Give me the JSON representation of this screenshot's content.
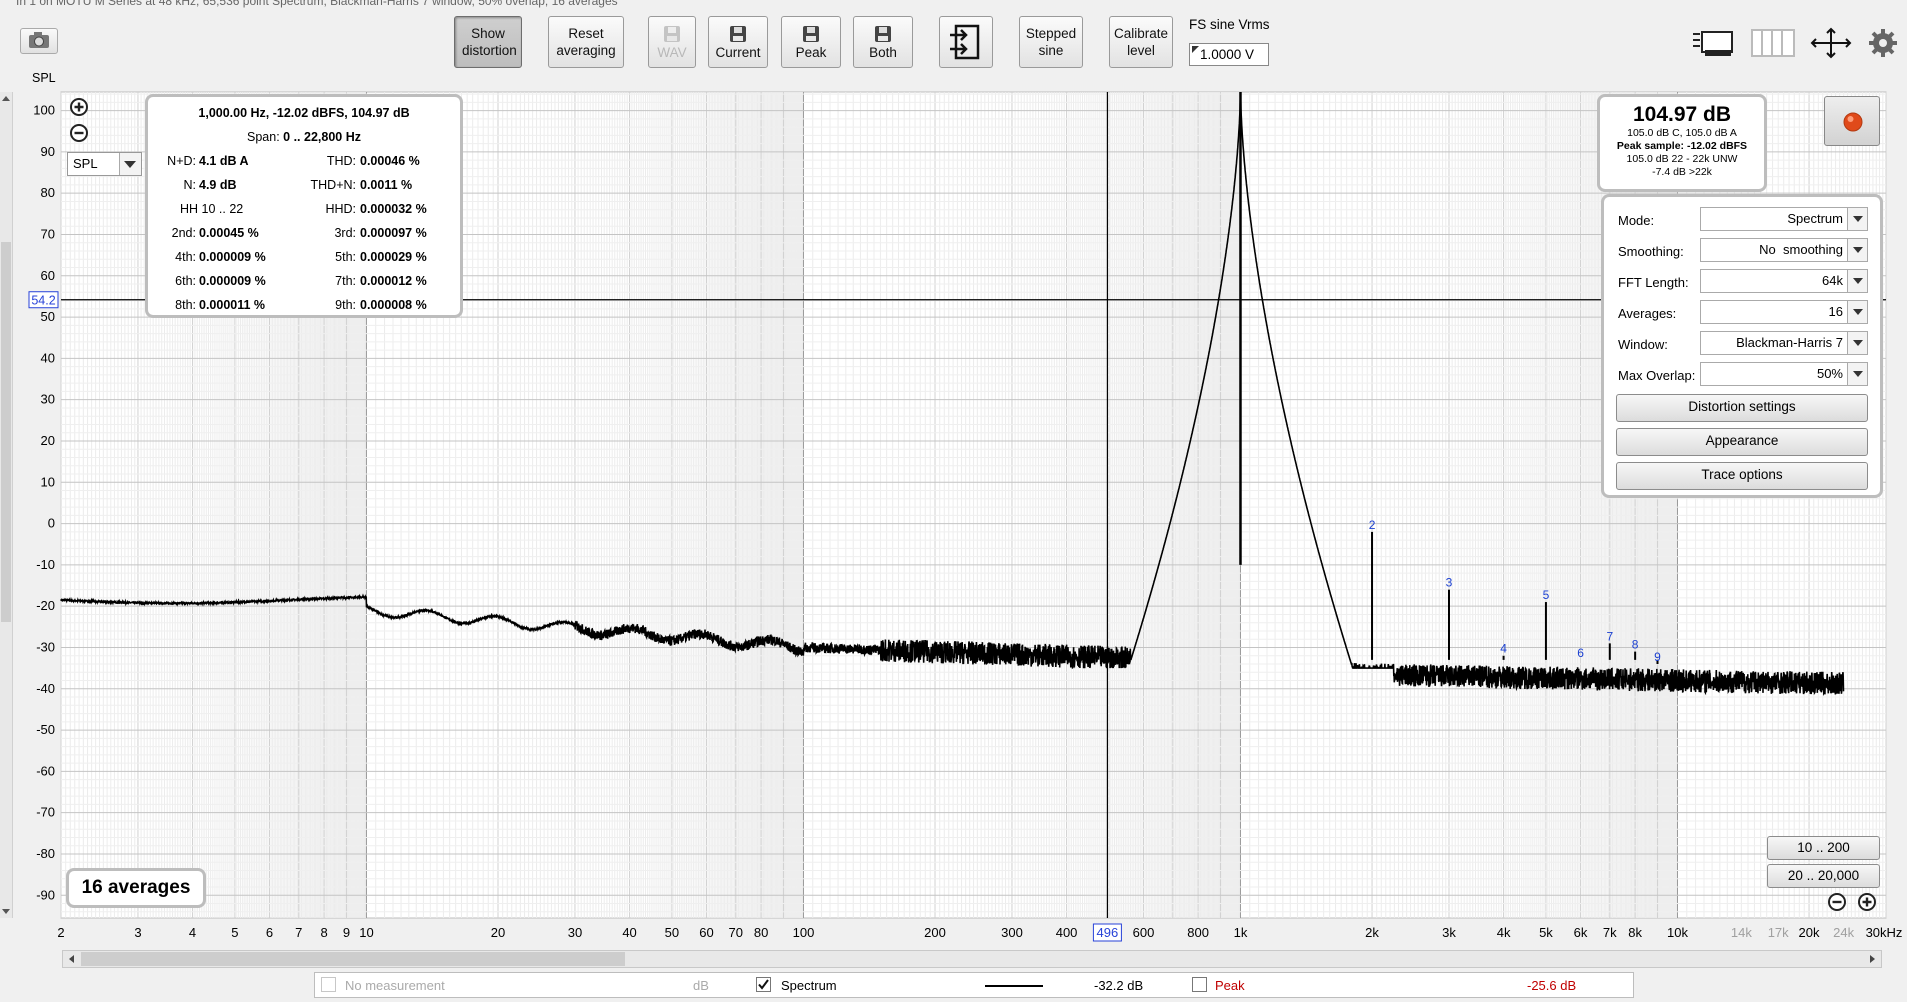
{
  "window": {
    "title": "In 1 on MOTU M Series at 48 kHz, 65,536 point Spectrum, Blackman-Harris 7 window, 50% overlap, 16 averages"
  },
  "toolbar": {
    "show_distortion": "Show distortion",
    "reset_averaging": "Reset averaging",
    "wav": "WAV",
    "current": "Current",
    "peak": "Peak",
    "both": "Both",
    "stepped_sine": "Stepped sine",
    "calibrate_level": "Calibrate level",
    "fs_sine_label": "FS sine Vrms",
    "fs_sine_value": "1.0000 V"
  },
  "graph": {
    "y_axis_title": "SPL",
    "y_ticks": [
      100,
      90,
      80,
      70,
      60,
      50,
      40,
      30,
      20,
      10,
      0,
      -10,
      -20,
      -30,
      -40,
      -50,
      -60,
      -70,
      -80,
      -90
    ],
    "x_ticks": [
      "2",
      "3",
      "4",
      "5",
      "6",
      "7",
      "8",
      "9",
      "10",
      "20",
      "30",
      "40",
      "50",
      "60",
      "70",
      "80",
      "100",
      "200",
      "300",
      "400",
      "600",
      "800",
      "1k",
      "2k",
      "3k",
      "4k",
      "5k",
      "6k",
      "7k",
      "8k",
      "10k",
      "14k",
      "17k",
      "20k",
      "24k",
      "30kHz"
    ],
    "x_ticks_grey": [
      "14k",
      "17k",
      "24k"
    ],
    "cursor_y_label": "54.2",
    "cursor_x_label": "496",
    "averages_badge": "16 averages",
    "spl_select": "SPL",
    "harmonic_markers": [
      "2",
      "3",
      "4",
      "5",
      "6",
      "7",
      "8",
      "9"
    ],
    "range_buttons": [
      "10 .. 200",
      "20 .. 20,000"
    ]
  },
  "distortion": {
    "header": "1,000.00 Hz, -12.02 dBFS, 104.97 dB",
    "span": {
      "label": "Span:",
      "value": "0 .. 22,800 Hz"
    },
    "rows": [
      {
        "l_label": "N+D:",
        "l_value": "4.1 dB A",
        "r_label": "THD:",
        "r_value": "0.00046 %"
      },
      {
        "l_label": "N:",
        "l_value": "4.9 dB",
        "r_label": "THD+N:",
        "r_value": "0.0011 %"
      },
      {
        "l_label": "",
        "l_value": "HH 10 .. 22",
        "r_label": "HHD:",
        "r_value": "0.000032 %"
      },
      {
        "l_label": "2nd:",
        "l_value": "0.00045 %",
        "r_label": "3rd:",
        "r_value": "0.000097 %"
      },
      {
        "l_label": "4th:",
        "l_value": "0.000009 %",
        "r_label": "5th:",
        "r_value": "0.000029 %"
      },
      {
        "l_label": "6th:",
        "l_value": "0.000009 %",
        "r_label": "7th:",
        "r_value": "0.000012 %"
      },
      {
        "l_label": "8th:",
        "l_value": "0.000011 %",
        "r_label": "9th:",
        "r_value": "0.000008 %"
      }
    ]
  },
  "level_readout": {
    "main": "104.97 dB",
    "lines": [
      "105.0 dB C, 105.0 dB A",
      "Peak sample: -12.02 dBFS",
      "105.0 dB 22 - 22k UNW",
      "-7.4 dB >22k"
    ]
  },
  "controls": {
    "mode": {
      "label": "Mode:",
      "value": "Spectrum"
    },
    "smoothing": {
      "label": "Smoothing:",
      "value": "No  smoothing"
    },
    "fft_length": {
      "label": "FFT Length:",
      "value": "64k"
    },
    "averages": {
      "label": "Averages:",
      "value": "16"
    },
    "window": {
      "label": "Window:",
      "value": "Blackman-Harris 7"
    },
    "max_overlap": {
      "label": "Max Overlap:",
      "value": "50%"
    },
    "distortion_settings": "Distortion settings",
    "appearance": "Appearance",
    "trace_options": "Trace options"
  },
  "statusbar": {
    "no_measurement": "No measurement",
    "db_unit": "dB",
    "spectrum": "Spectrum",
    "spectrum_value": "-32.2 dB",
    "peak": "Peak",
    "peak_value": "-25.6 dB"
  },
  "colors": {
    "grid_minor": "#e2e2e2",
    "grid_major": "#a8a8a8",
    "trace": "#000000",
    "marker": "#1a3fd1",
    "peak_text": "#c00000",
    "record_button": "#e04a1a"
  }
}
